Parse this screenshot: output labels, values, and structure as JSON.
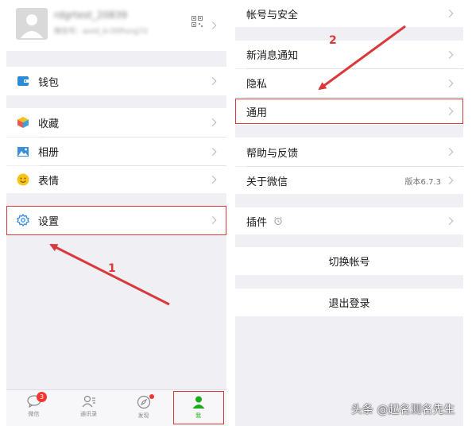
{
  "profile": {
    "name": "rdgrtest_20839",
    "wechat_id": "微信号：wxid_kr35fhxnjj72"
  },
  "left_menu": {
    "wallet": "钱包",
    "favorites": "收藏",
    "album": "相册",
    "stickers": "表情",
    "settings": "设置"
  },
  "right_menu": {
    "account_security": "帐号与安全",
    "new_message_notifications": "新消息通知",
    "privacy": "隐私",
    "general": "通用",
    "help_feedback": "帮助与反馈",
    "about": "关于微信",
    "version": "版本6.7.3",
    "plugins": "插件",
    "switch_account": "切换帐号",
    "logout": "退出登录"
  },
  "tab_bar": {
    "chats": "微信",
    "chats_badge": "3",
    "contacts": "通讯录",
    "discover": "发现",
    "me": "我"
  },
  "annotations": {
    "step1": "1",
    "step2": "2"
  },
  "watermark": "头条 @起名测名先生",
  "colors": {
    "highlight": "#d9393a",
    "active_tab": "#1aad19",
    "badge": "#f43530",
    "background": "#efeff4"
  }
}
